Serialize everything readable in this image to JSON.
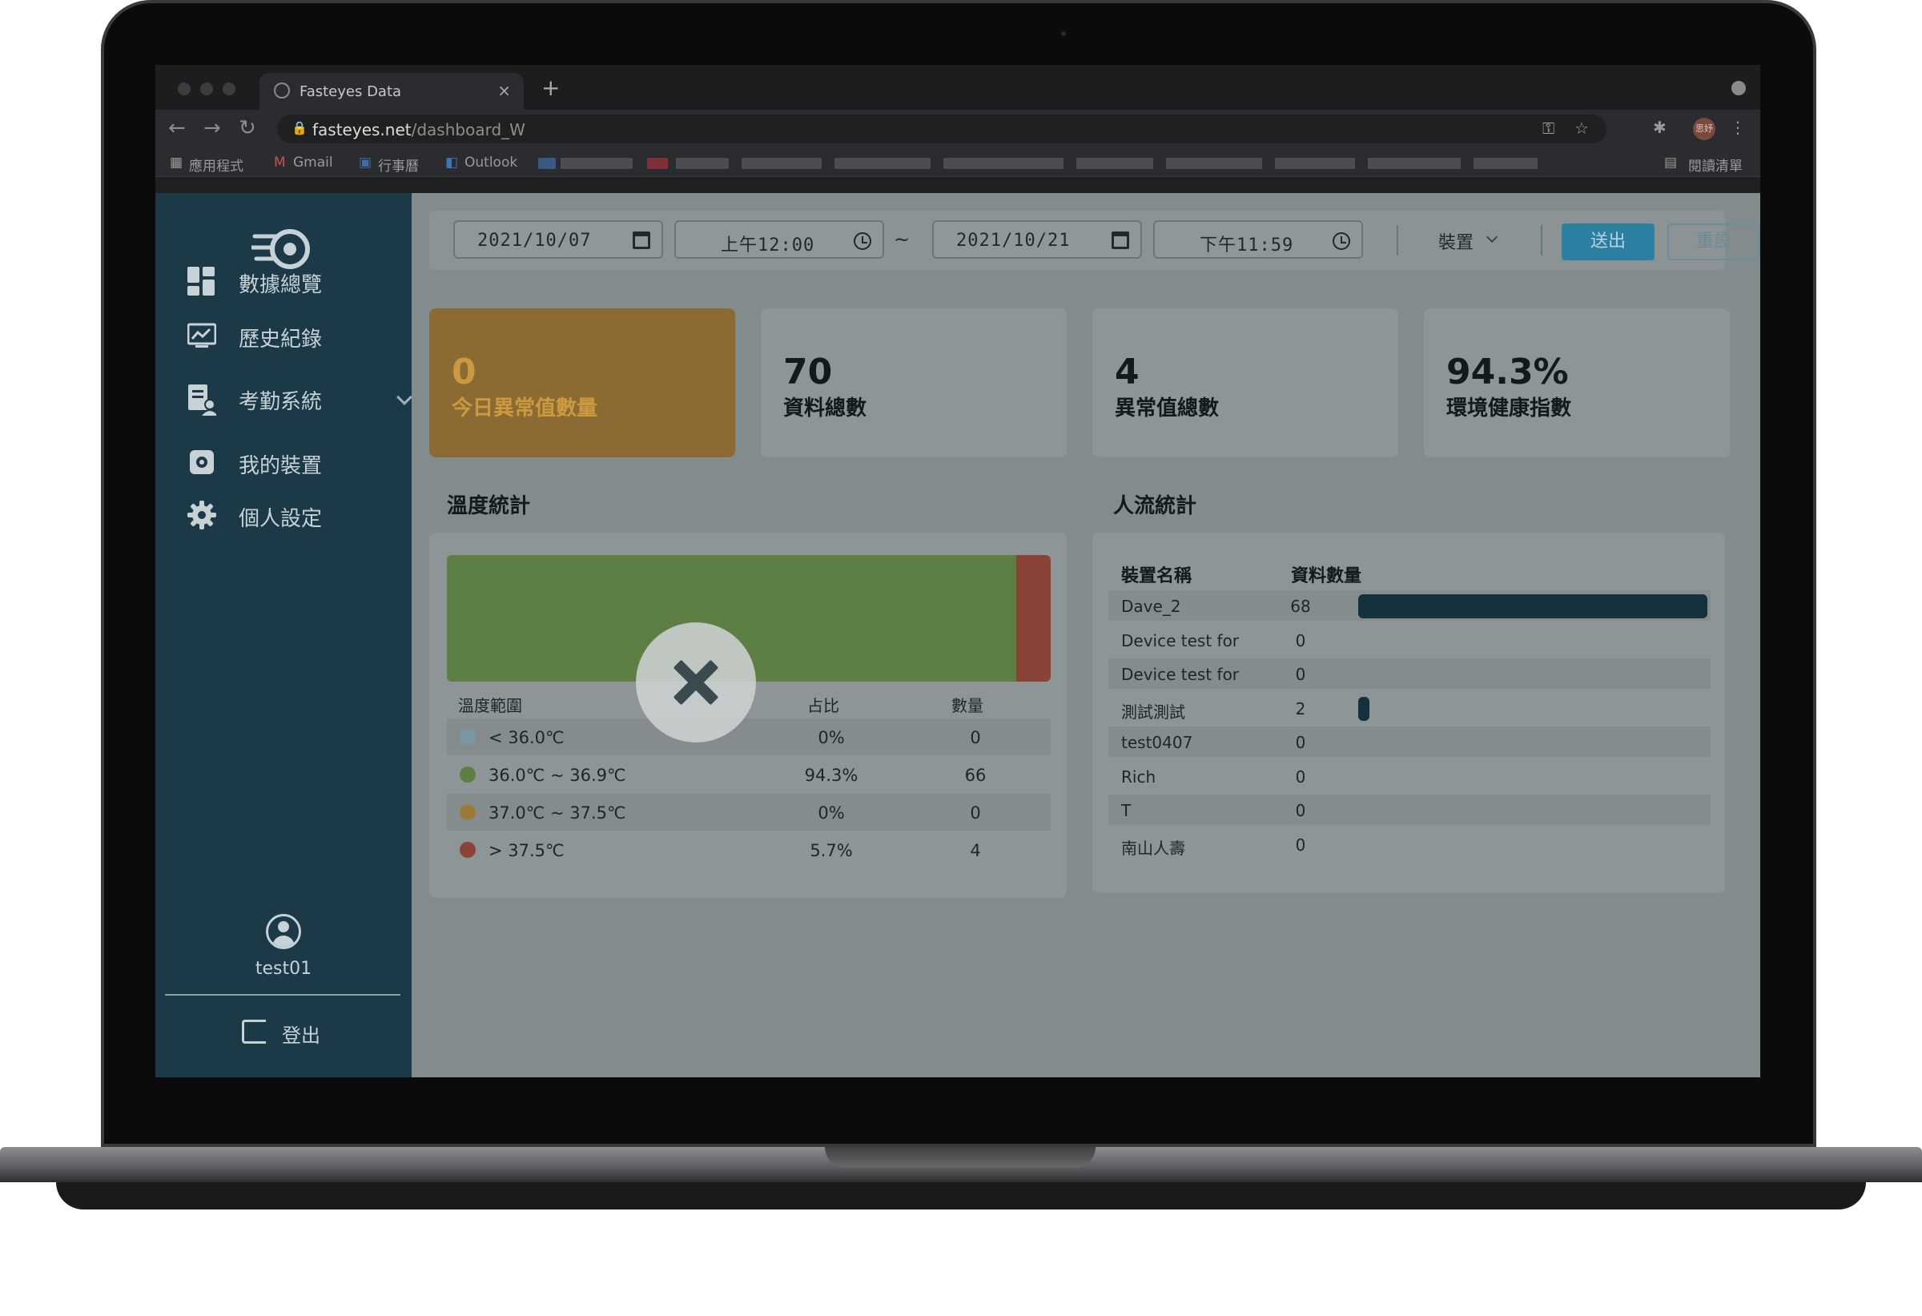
{
  "browser": {
    "tab_title": "Fasteyes Data",
    "tab_close": "×",
    "new_tab": "+",
    "url_host": "fasteyes.net",
    "url_path": "/dashboard_W",
    "profile_label": "思妤",
    "bookmarks": [
      {
        "label": "應用程式",
        "icon": "apps-grid-icon"
      },
      {
        "label": "Gmail",
        "icon": "gmail-icon"
      },
      {
        "label": "行事曆",
        "icon": "calendar-icon"
      },
      {
        "label": "Outlook",
        "icon": "outlook-icon"
      }
    ],
    "reading_list": "閱讀清單"
  },
  "sidebar": {
    "nav": [
      {
        "label": "數據總覽",
        "icon": "dashboard-icon"
      },
      {
        "label": "歷史紀錄",
        "icon": "history-icon"
      },
      {
        "label": "考勤系統",
        "icon": "attendance-icon",
        "expandable": true
      },
      {
        "label": "我的裝置",
        "icon": "device-icon"
      },
      {
        "label": "個人設定",
        "icon": "gear-icon"
      }
    ],
    "username": "test01",
    "logout": "登出"
  },
  "filter": {
    "start_date": "2021/10/07",
    "start_time": "上午12:00",
    "separator": "~",
    "end_date": "2021/10/21",
    "end_time": "下午11:59",
    "device_select": "裝置",
    "submit": "送出",
    "reset": "重設"
  },
  "stats": [
    {
      "value": "0",
      "label": "今日異常值數量"
    },
    {
      "value": "70",
      "label": "資料總數"
    },
    {
      "value": "4",
      "label": "異常值總數"
    },
    {
      "value": "94.3%",
      "label": "環境健康指數"
    }
  ],
  "temperature": {
    "title": "溫度統計",
    "headers": {
      "range": "溫度範圍",
      "ratio": "占比",
      "count": "數量"
    },
    "rows": [
      {
        "range": "< 36.0℃",
        "ratio": "0%",
        "count": "0",
        "color": "#7b98a7"
      },
      {
        "range": "36.0℃ ~ 36.9℃",
        "ratio": "94.3%",
        "count": "66",
        "color": "#5d7f44"
      },
      {
        "range": "37.0℃ ~ 37.5℃",
        "ratio": "0%",
        "count": "0",
        "color": "#9a7b3a"
      },
      {
        "range": "> 37.5℃",
        "ratio": "5.7%",
        "count": "4",
        "color": "#8a4336"
      }
    ]
  },
  "people_flow": {
    "title": "人流統計",
    "headers": {
      "name": "裝置名稱",
      "count": "資料數量"
    },
    "max": 68,
    "rows": [
      {
        "name": "Dave_2",
        "count": "68",
        "value": 68
      },
      {
        "name": "Device test for",
        "count": "0",
        "value": 0
      },
      {
        "name": "Device test for",
        "count": "0",
        "value": 0
      },
      {
        "name": "測試測試",
        "count": "2",
        "value": 2
      },
      {
        "name": "test0407",
        "count": "0",
        "value": 0
      },
      {
        "name": "Rich",
        "count": "0",
        "value": 0
      },
      {
        "name": "T",
        "count": "0",
        "value": 0
      },
      {
        "name": "南山人壽",
        "count": "0",
        "value": 0
      }
    ]
  },
  "colors": {
    "sidebar": "#1b3947",
    "alert_card": "#8b6b33",
    "submit_button": "#2b7fa0",
    "flow_bar": "#15313e"
  }
}
